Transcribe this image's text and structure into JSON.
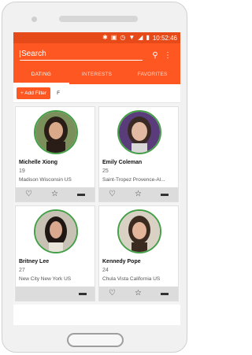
{
  "status": {
    "time": "10:52:46"
  },
  "search": {
    "placeholder": "Search"
  },
  "tabs": [
    {
      "label": "DATING"
    },
    {
      "label": "INTERESTS"
    },
    {
      "label": "FAVORITES"
    }
  ],
  "filter": {
    "button": "+ Add Filter",
    "chip": "F"
  },
  "profiles": [
    {
      "name": "Michelle Xiong",
      "age": "19",
      "location": "Madison Wisconsin US",
      "skin": "#d9a98a",
      "hair": "#2a1d17",
      "bg": "#7a8f5a"
    },
    {
      "name": "Emily Coleman",
      "age": "25",
      "location": "Saint-Tropez Provence-Al...",
      "skin": "#e2b9a3",
      "hair": "#3a2a25",
      "bg": "#5a3c7a"
    },
    {
      "name": "Britney Lee",
      "age": "27",
      "location": "New City New York US",
      "skin": "#d8a98f",
      "hair": "#1f1713",
      "bg": "#c8c2b5"
    },
    {
      "name": "Kennedy Pope",
      "age": "24",
      "location": "Chula Vista California US",
      "skin": "#e3b69c",
      "hair": "#3b2a20",
      "bg": "#d9d1c4"
    }
  ]
}
